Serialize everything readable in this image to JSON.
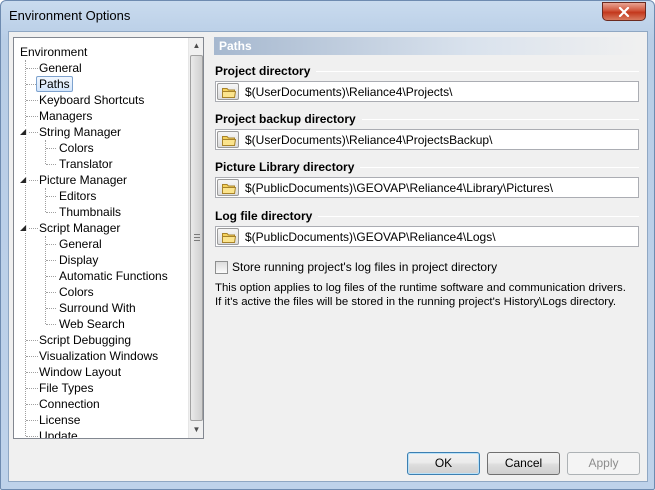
{
  "window": {
    "title": "Environment Options"
  },
  "tree": {
    "items": [
      {
        "label": "Environment",
        "level": 0
      },
      {
        "label": "General",
        "level": 1
      },
      {
        "label": "Paths",
        "level": 1,
        "selected": true
      },
      {
        "label": "Keyboard Shortcuts",
        "level": 1
      },
      {
        "label": "Managers",
        "level": 1
      },
      {
        "label": "String Manager",
        "level": 1,
        "expanded": true
      },
      {
        "label": "Colors",
        "level": 2
      },
      {
        "label": "Translator",
        "level": 2
      },
      {
        "label": "Picture Manager",
        "level": 1,
        "expanded": true
      },
      {
        "label": "Editors",
        "level": 2
      },
      {
        "label": "Thumbnails",
        "level": 2
      },
      {
        "label": "Script Manager",
        "level": 1,
        "expanded": true
      },
      {
        "label": "General",
        "level": 2
      },
      {
        "label": "Display",
        "level": 2
      },
      {
        "label": "Automatic Functions",
        "level": 2
      },
      {
        "label": "Colors",
        "level": 2
      },
      {
        "label": "Surround With",
        "level": 2
      },
      {
        "label": "Web Search",
        "level": 2
      },
      {
        "label": "Script Debugging",
        "level": 1
      },
      {
        "label": "Visualization Windows",
        "level": 1
      },
      {
        "label": "Window Layout",
        "level": 1
      },
      {
        "label": "File Types",
        "level": 1
      },
      {
        "label": "Connection",
        "level": 1
      },
      {
        "label": "License",
        "level": 1
      },
      {
        "label": "Update",
        "level": 1
      }
    ]
  },
  "pane": {
    "title": "Paths",
    "sections": [
      {
        "label": "Project directory",
        "value": "$(UserDocuments)\\Reliance4\\Projects\\"
      },
      {
        "label": "Project backup directory",
        "value": "$(UserDocuments)\\Reliance4\\ProjectsBackup\\"
      },
      {
        "label": "Picture Library directory",
        "value": "$(PublicDocuments)\\GEOVAP\\Reliance4\\Library\\Pictures\\"
      },
      {
        "label": "Log file directory",
        "value": "$(PublicDocuments)\\GEOVAP\\Reliance4\\Logs\\"
      }
    ],
    "checkbox": {
      "label": "Store running project's log files in project directory",
      "checked": false
    },
    "info": "This option applies to log files of the runtime software and communication drivers. If it's active the files will be stored in the running project's History\\Logs directory."
  },
  "buttons": {
    "ok": "OK",
    "cancel": "Cancel",
    "apply": "Apply"
  },
  "icons": {
    "close": "close-icon",
    "folder": "folder-icon",
    "expand": "collapse-triangle-icon"
  }
}
